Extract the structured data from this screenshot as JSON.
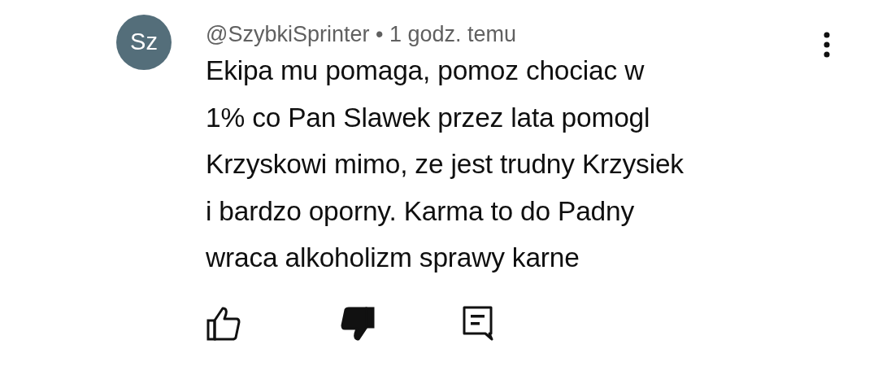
{
  "comment": {
    "avatar": "Sz",
    "author": "@SzybkiSprinter",
    "separator": "•",
    "time": "1 godz. temu",
    "lines": [
      "Ekipa mu pomaga, pomoz chociac w",
      "1% co Pan Slawek przez lata pomogl",
      "Krzyskowi mimo, ze jest trudny Krzysiek",
      "i bardzo oporny. Karma to do Padny",
      "wraca alkoholizm sprawy karne"
    ],
    "liked": false,
    "disliked": true
  }
}
